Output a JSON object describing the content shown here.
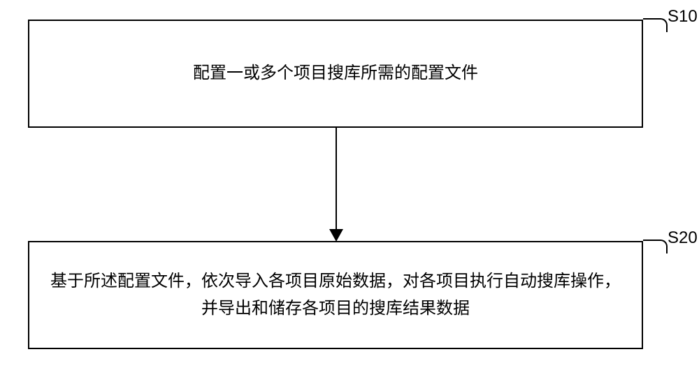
{
  "diagram": {
    "steps": [
      {
        "id": "S10",
        "text": "配置一或多个项目搜库所需的配置文件"
      },
      {
        "id": "S20",
        "text": "基于所述配置文件，依次导入各项目原始数据，对各项目执行自动搜库操作，并导出和储存各项目的搜库结果数据"
      }
    ]
  }
}
